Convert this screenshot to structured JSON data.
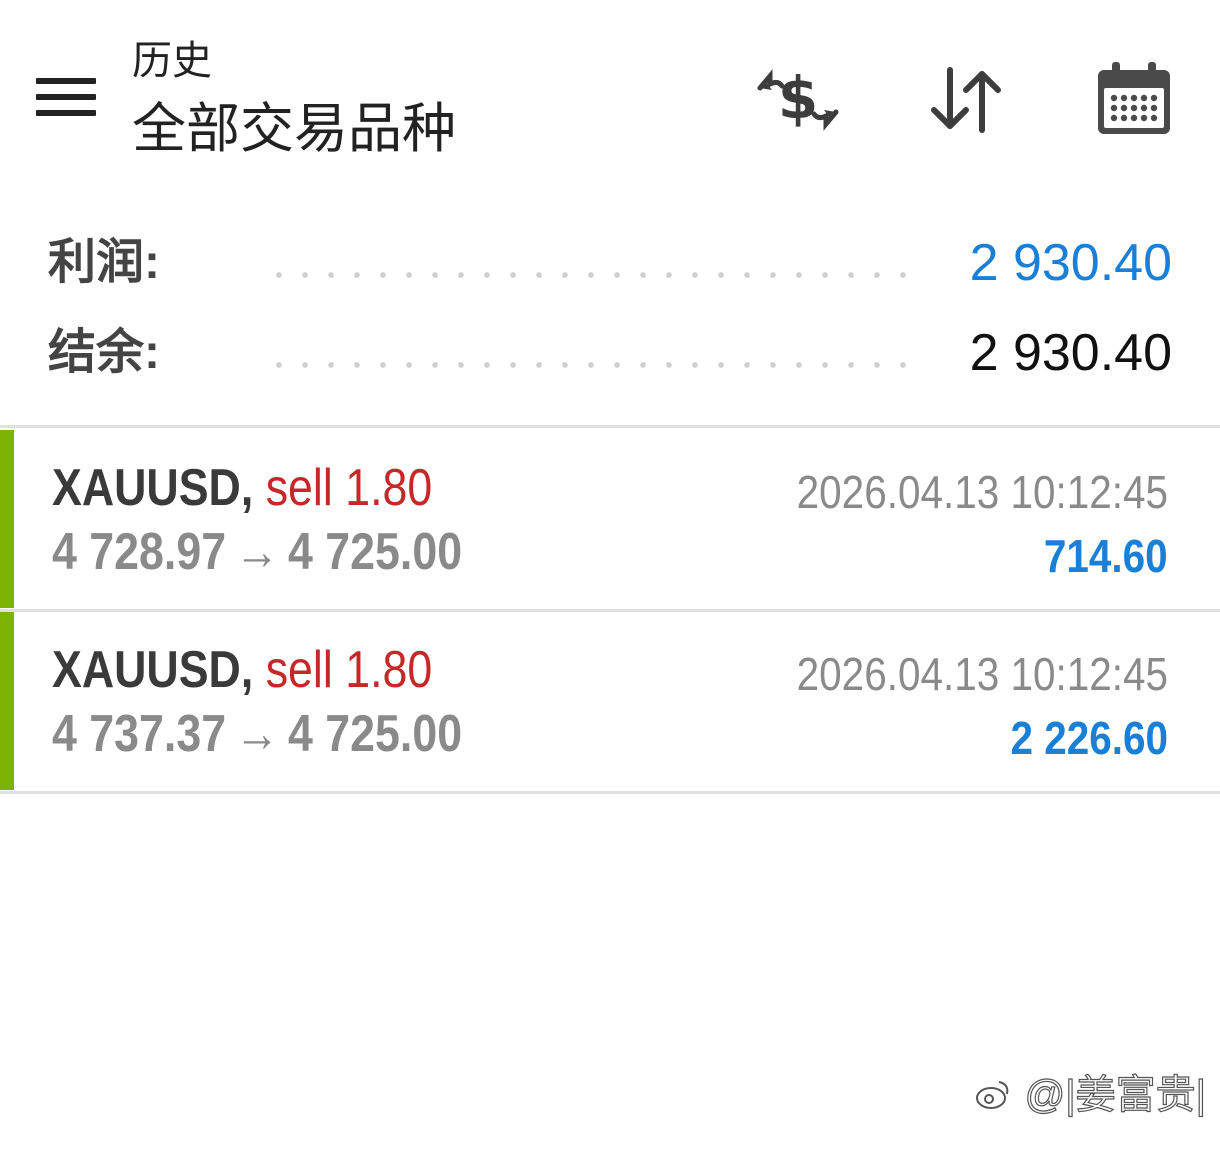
{
  "header": {
    "subtitle": "历史",
    "title": "全部交易品种",
    "menu_icon": "hamburger-menu-icon",
    "actions": [
      {
        "name": "currency-exchange-icon"
      },
      {
        "name": "sort-icon"
      },
      {
        "name": "calendar-icon"
      }
    ]
  },
  "summary": {
    "profit_label": "利润:",
    "profit_value": "2 930.40",
    "balance_label": "结余:",
    "balance_value": "2 930.40"
  },
  "trades": [
    {
      "symbol": "XAUUSD",
      "separator": ",",
      "side": "sell",
      "lots": "1.80",
      "open_price": "4 728.97",
      "arrow": "→",
      "close_price": "4 725.00",
      "time": "2026.04.13 10:12:45",
      "profit": "714.60"
    },
    {
      "symbol": "XAUUSD",
      "separator": ",",
      "side": "sell",
      "lots": "1.80",
      "open_price": "4 737.37",
      "arrow": "→",
      "close_price": "4 725.00",
      "time": "2026.04.13 10:12:45",
      "profit": "2 226.60"
    }
  ],
  "watermark": {
    "text": "@|姜富贵|",
    "logo_icon": "weibo-logo-icon"
  },
  "colors": {
    "profit_blue": "#1a7fd6",
    "sell_red": "#c62828",
    "trade_bar_green": "#7cb404",
    "muted_gray": "#8a8a8a"
  }
}
